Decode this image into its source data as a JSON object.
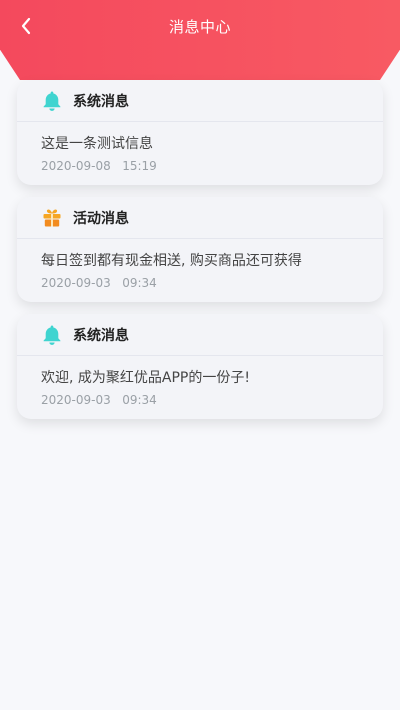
{
  "header": {
    "title": "消息中心",
    "back_icon": "chevron-left-icon",
    "colors": {
      "from": "#f4495d",
      "to": "#f85a63"
    }
  },
  "messages": [
    {
      "type": "系统消息",
      "icon": "bell-icon",
      "icon_color": "#3fd4d0",
      "content": "这是一条测试信息",
      "date": "2020-09-08",
      "time": "15:19"
    },
    {
      "type": "活动消息",
      "icon": "gift-icon",
      "icon_color": "#f6a623",
      "content": "每日签到都有现金相送, 购买商品还可获得",
      "date": "2020-09-03",
      "time": "09:34"
    },
    {
      "type": "系统消息",
      "icon": "bell-icon",
      "icon_color": "#3fd4d0",
      "content": "欢迎, 成为聚红优品APP的一份子!",
      "date": "2020-09-03",
      "time": "09:34"
    }
  ]
}
